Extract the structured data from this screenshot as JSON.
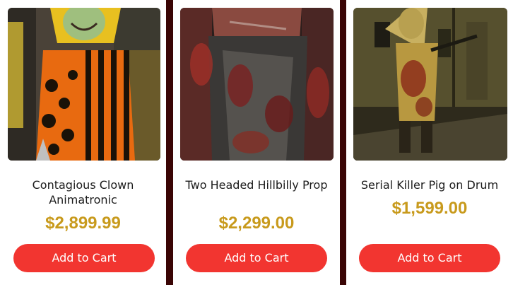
{
  "products": [
    {
      "title": "Contagious Clown Animatronic",
      "price": "$2,899.99",
      "button_label": "Add to Cart",
      "image_name": "contagious-clown-image"
    },
    {
      "title": "Two Headed Hillbilly Prop",
      "price": "$2,299.00",
      "button_label": "Add to Cart",
      "image_name": "hillbilly-prop-image"
    },
    {
      "title": "Serial Killer Pig on Drum",
      "price": "$1,599.00",
      "button_label": "Add to Cart",
      "image_name": "serial-killer-pig-image"
    }
  ],
  "colors": {
    "page_background": "#3a0505",
    "card_background": "#ffffff",
    "price": "#c89a1c",
    "button": "#f23530",
    "title": "#1c1c1c"
  }
}
